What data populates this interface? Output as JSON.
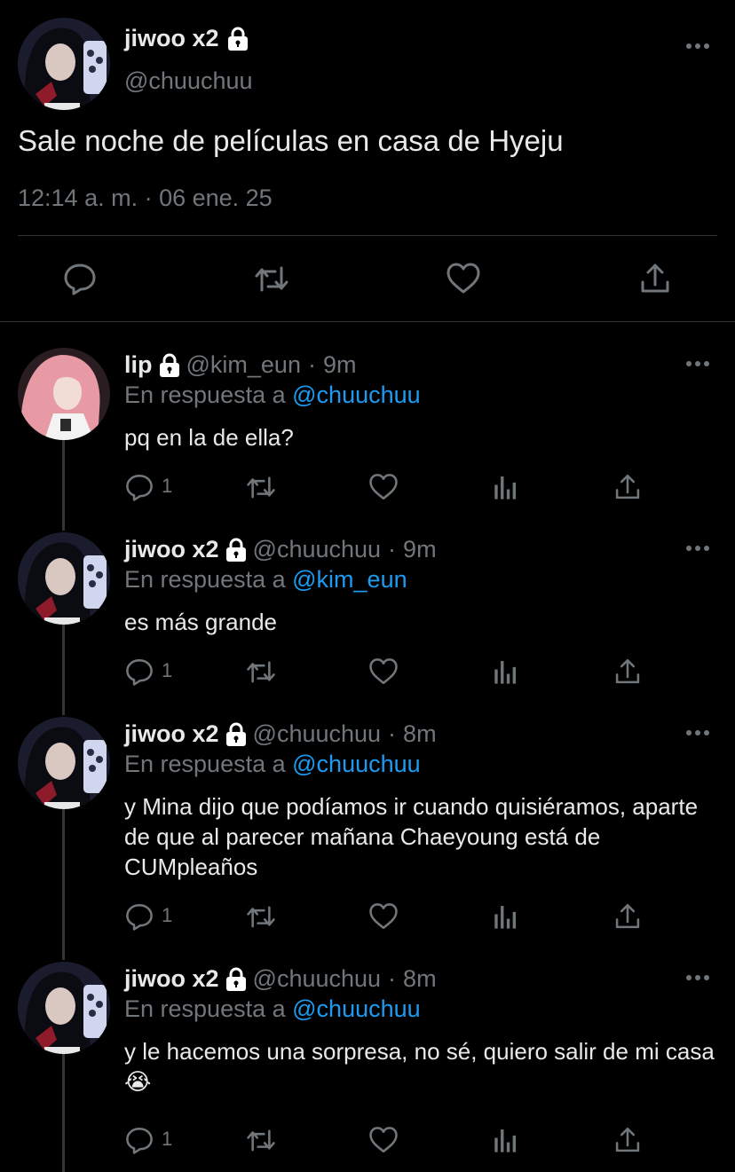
{
  "main_tweet": {
    "name": "jiwoo x2",
    "handle": "@chuuchuu",
    "text": "Sale noche de películas en casa de Hyeju",
    "timestamp": "12:14 a. m. · 06 ene. 25",
    "actions": [
      "reply-icon",
      "retweet-icon",
      "like-icon",
      "share-icon"
    ]
  },
  "replies": [
    {
      "name": "lip",
      "handle": "@kim_eun",
      "separator": "·",
      "time": "9m",
      "reply_prefix": "En respuesta a",
      "reply_to": "@chuuchuu",
      "text": "pq en la de ella?",
      "reply_count": "1",
      "avatar": "pink-hair-avatar"
    },
    {
      "name": "jiwoo x2",
      "handle": "@chuuchuu",
      "separator": "·",
      "time": "9m",
      "reply_prefix": "En respuesta a",
      "reply_to": "@kim_eun",
      "text": "es más grande",
      "reply_count": "1",
      "avatar": "dark-hair-avatar"
    },
    {
      "name": "jiwoo x2",
      "handle": "@chuuchuu",
      "separator": "·",
      "time": "8m",
      "reply_prefix": "En respuesta a",
      "reply_to": "@chuuchuu",
      "text": "y Mina dijo que podíamos ir cuando quisiéramos, aparte de que al parecer mañana Chaeyoung está de CUMpleaños",
      "reply_count": "1",
      "avatar": "dark-hair-avatar"
    },
    {
      "name": "jiwoo x2",
      "handle": "@chuuchuu",
      "separator": "·",
      "time": "8m",
      "reply_prefix": "En respuesta a",
      "reply_to": "@chuuchuu",
      "text": "y le hacemos una sorpresa, no sé, quiero salir de mi casa 😭",
      "reply_count": "1",
      "avatar": "dark-hair-avatar"
    }
  ],
  "colors": {
    "background": "#000000",
    "text": "#e7e9ea",
    "secondary": "#71767b",
    "link": "#1d9bf0",
    "divider": "#2f3336"
  }
}
